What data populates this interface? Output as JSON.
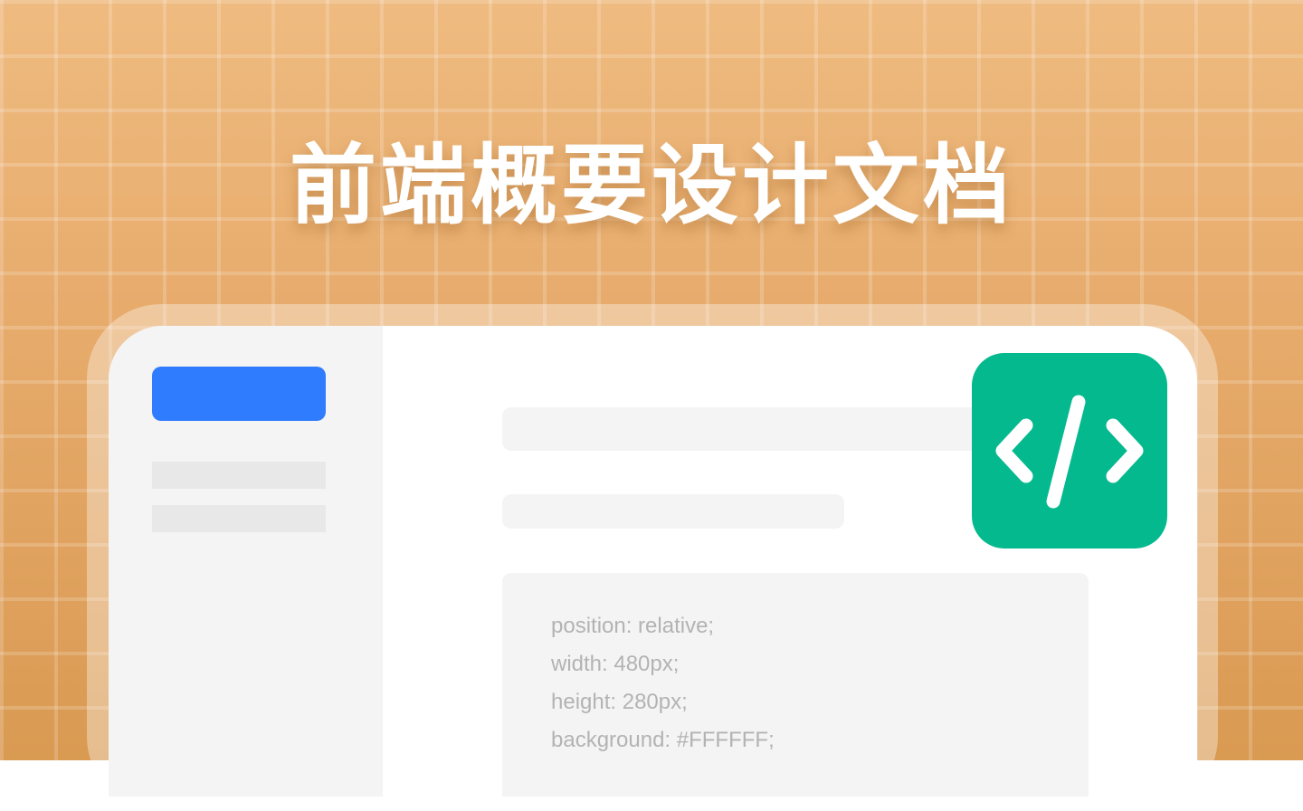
{
  "title": "前端概要设计文档",
  "code_lines": [
    "position: relative;",
    "width: 480px;",
    "height: 280px;",
    "background: #FFFFFF;"
  ],
  "colors": {
    "primary_button": "#2f7cff",
    "badge": "#04b98e",
    "background": "#e6aa6a"
  },
  "icons": {
    "badge_icon": "code-icon"
  }
}
